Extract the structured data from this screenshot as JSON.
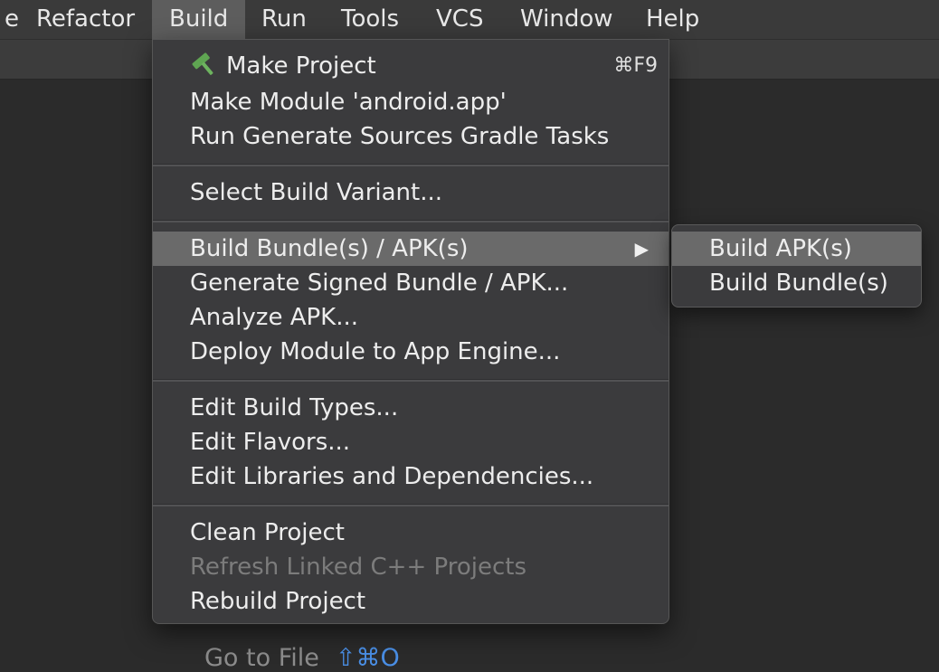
{
  "menubar": {
    "items": [
      {
        "label": "e"
      },
      {
        "label": "Refactor"
      },
      {
        "label": "Build"
      },
      {
        "label": "Run"
      },
      {
        "label": "Tools"
      },
      {
        "label": "VCS"
      },
      {
        "label": "Window"
      },
      {
        "label": "Help"
      }
    ],
    "active": "Build"
  },
  "build_menu": {
    "make_project": {
      "label": "Make Project",
      "shortcut": "⌘F9",
      "icon": "hammer-icon"
    },
    "make_module": {
      "label": "Make Module 'android.app'"
    },
    "run_generate": {
      "label": "Run Generate Sources Gradle Tasks"
    },
    "select_variant": {
      "label": "Select Build Variant..."
    },
    "build_bundle": {
      "label": "Build Bundle(s) / APK(s)",
      "submenu_arrow": "▶"
    },
    "generate_signed": {
      "label": "Generate Signed Bundle / APK..."
    },
    "analyze_apk": {
      "label": "Analyze APK..."
    },
    "deploy_module": {
      "label": "Deploy Module to App Engine..."
    },
    "edit_build_types": {
      "label": "Edit Build Types..."
    },
    "edit_flavors": {
      "label": "Edit Flavors..."
    },
    "edit_libraries": {
      "label": "Edit Libraries and Dependencies..."
    },
    "clean_project": {
      "label": "Clean Project"
    },
    "refresh_cpp": {
      "label": "Refresh Linked C++ Projects",
      "disabled": true
    },
    "rebuild_project": {
      "label": "Rebuild Project"
    }
  },
  "build_submenu": {
    "build_apk": {
      "label": "Build APK(s)"
    },
    "build_bundles": {
      "label": "Build Bundle(s)"
    }
  },
  "editor": {
    "goto_file_label": "Go to File",
    "goto_file_shortcut": "⇧⌘O"
  },
  "colors": {
    "menubar_bg": "#3a3a3a",
    "menu_bg": "#3b3b3d",
    "highlight": "#6a6a6a",
    "hammer_green": "#5fa552",
    "shortcut_blue": "#4a8fe6"
  }
}
